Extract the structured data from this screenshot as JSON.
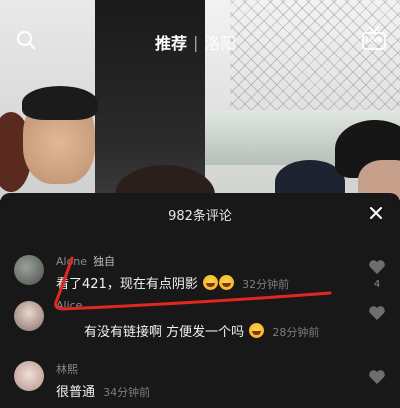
{
  "header": {
    "tab_recommend": "推荐",
    "tab_separator": "|",
    "tab_city": "洛阳",
    "live_label": "LIVE"
  },
  "comments_panel": {
    "title": "982条评论",
    "comments": [
      {
        "username": "Alone",
        "user_tag": "独自",
        "text": "看了421，现在有点阴影",
        "emojis": [
          "laughing-tears-emoji",
          "laughing-tears-emoji"
        ],
        "time": "32分钟前",
        "likes": "4"
      },
      {
        "username": "Alice",
        "text": "有没有链接啊 方便发一个吗",
        "emojis": [
          "smiling-emoji"
        ],
        "time": "28分钟前"
      },
      {
        "username": "林熙",
        "text": "很普通",
        "time": "34分钟前"
      }
    ]
  },
  "colors": {
    "sheet_background": "#181818",
    "annotation_red": "#e0281f",
    "secondary_text": "#8c8c8c"
  },
  "icons": [
    "search-icon",
    "live-icon",
    "close-icon",
    "heart-icon"
  ]
}
